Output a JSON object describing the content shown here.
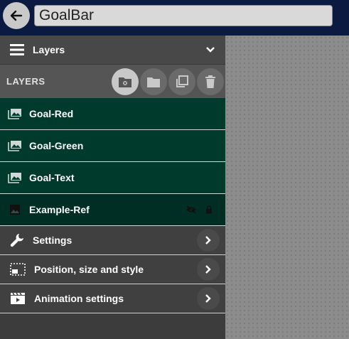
{
  "header": {
    "title": "GoalBar",
    "back_icon": "arrow-left-icon"
  },
  "panel": {
    "title": "Layers",
    "icon": "menu-lines-icon"
  },
  "toolbar": {
    "label": "LAYERS",
    "buttons": [
      "folder-add-icon",
      "folder-icon",
      "duplicate-icon",
      "trash-icon"
    ]
  },
  "layers": [
    {
      "name": "Goal-Red",
      "icon": "image-stack-icon"
    },
    {
      "name": "Goal-Green",
      "icon": "image-stack-icon"
    },
    {
      "name": "Goal-Text",
      "icon": "image-stack-icon"
    },
    {
      "name": "Example-Ref",
      "icon": "image-icon",
      "hidden": true,
      "locked": true
    }
  ],
  "menu": [
    {
      "label": "Settings",
      "icon": "wrench-icon"
    },
    {
      "label": "Position, size and style",
      "icon": "layout-icon"
    },
    {
      "label": "Animation settings",
      "icon": "clapperboard-icon"
    }
  ],
  "colors": {
    "header_bg": "#0b1a40",
    "layer_bg": "#003a2c",
    "panel_bg": "#3c3c3c",
    "canvas_bg": "#8c8c8c"
  }
}
